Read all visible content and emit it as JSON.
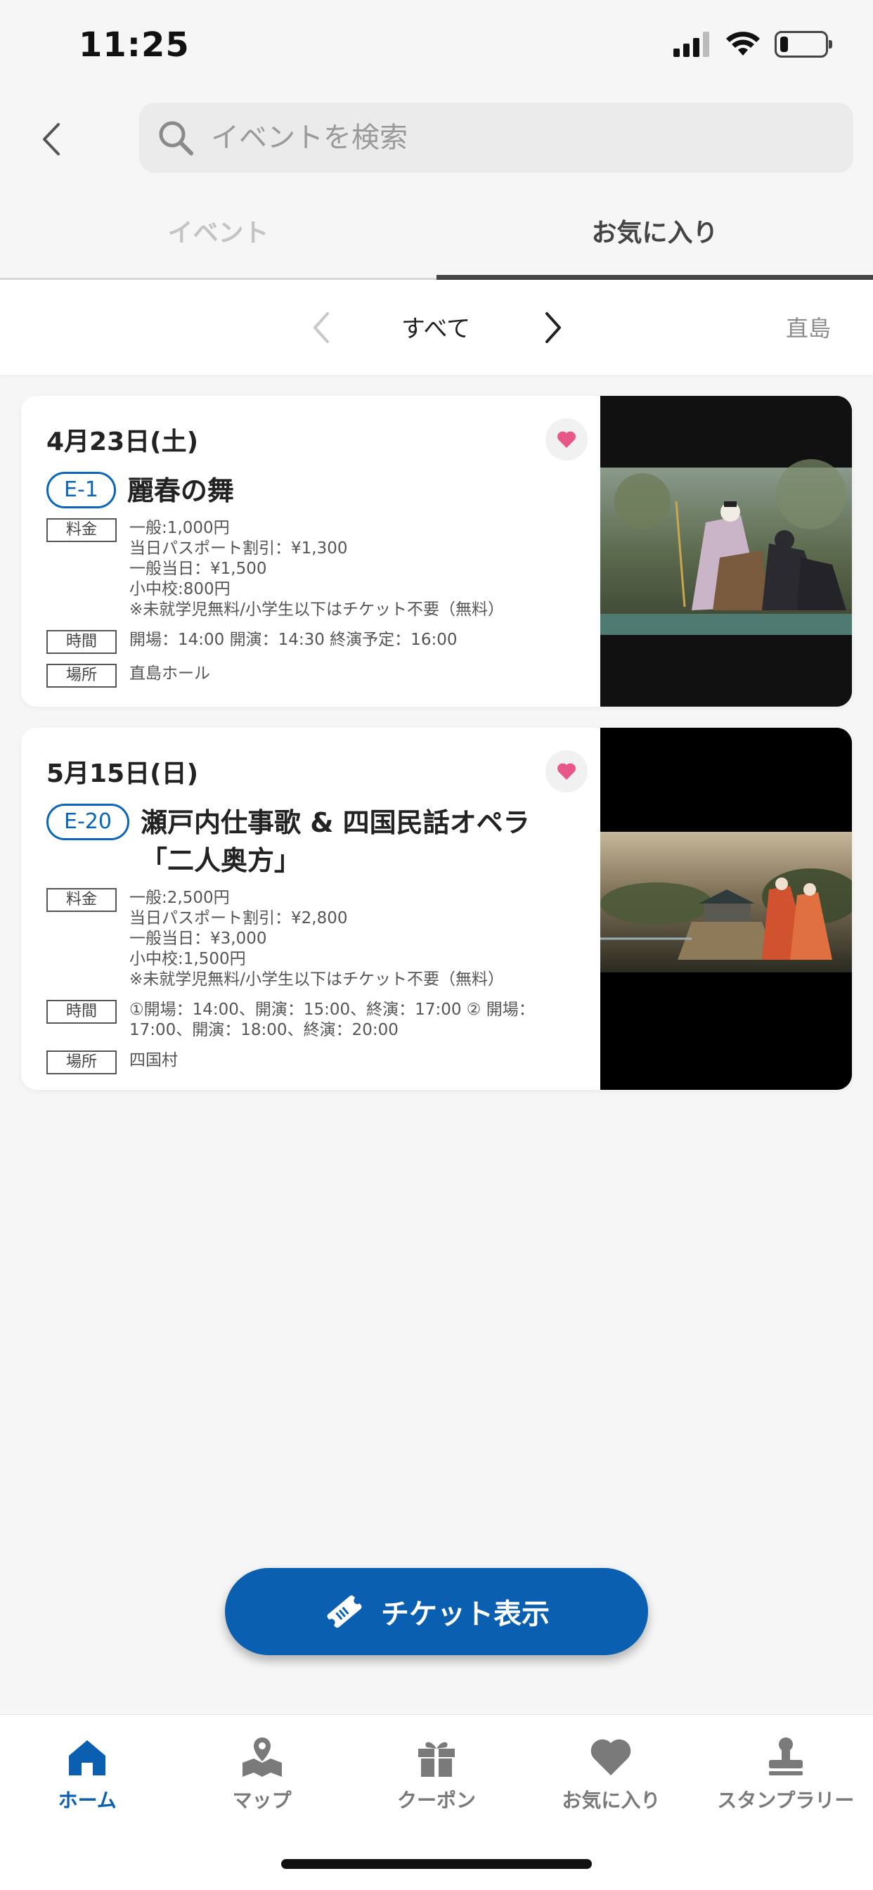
{
  "status_bar": {
    "time": "11:25",
    "battery_level": 0.18
  },
  "search": {
    "placeholder": "イベントを検索"
  },
  "tabs": [
    {
      "label": "イベント",
      "active": false
    },
    {
      "label": "お気に入り",
      "active": true
    }
  ],
  "filter": {
    "current": "すべて",
    "next_label": "直島"
  },
  "events": [
    {
      "date": "4月23日(土)",
      "code": "E-1",
      "title": "麗春の舞",
      "favorite": true,
      "price_label": "料金",
      "price_lines": [
        "一般:1,000円",
        "当日パスポート割引：¥1,300",
        "一般当日：¥1,500",
        "小中校:800円",
        "※未就学児無料/小学生以下はチケット不要（無料）"
      ],
      "time_label": "時間",
      "time_lines": [
        "開場：14:00 開演：14:30 終演予定：16:00"
      ],
      "place_label": "場所",
      "place": "直島ホール"
    },
    {
      "date": "5月15日(日)",
      "code": "E-20",
      "title": "瀬戸内仕事歌 & 四国民話オペラ「二人奥方」",
      "favorite": true,
      "price_label": "料金",
      "price_lines": [
        "一般:2,500円",
        "当日パスポート割引：¥2,800",
        "一般当日：¥3,000",
        "小中校:1,500円",
        "※未就学児無料/小学生以下はチケット不要（無料）"
      ],
      "time_label": "時間",
      "time_lines": [
        "①開場：14:00、開演：15:00、終演：17:00 ② 開場：",
        "17:00、開演：18:00、終演：20:00"
      ],
      "place_label": "場所",
      "place": "四国村"
    }
  ],
  "ticket_button": {
    "label": "チケット表示"
  },
  "bottom_nav": [
    {
      "label": "ホーム",
      "icon": "home-icon",
      "active": true
    },
    {
      "label": "マップ",
      "icon": "map-icon",
      "active": false
    },
    {
      "label": "クーポン",
      "icon": "gift-icon",
      "active": false
    },
    {
      "label": "お気に入り",
      "icon": "heart-icon",
      "active": false
    },
    {
      "label": "スタンプラリー",
      "icon": "stamp-icon",
      "active": false
    }
  ],
  "colors": {
    "accent": "#0a5fb0",
    "heart": "#e8578a",
    "badge_border": "#0a66b8"
  }
}
